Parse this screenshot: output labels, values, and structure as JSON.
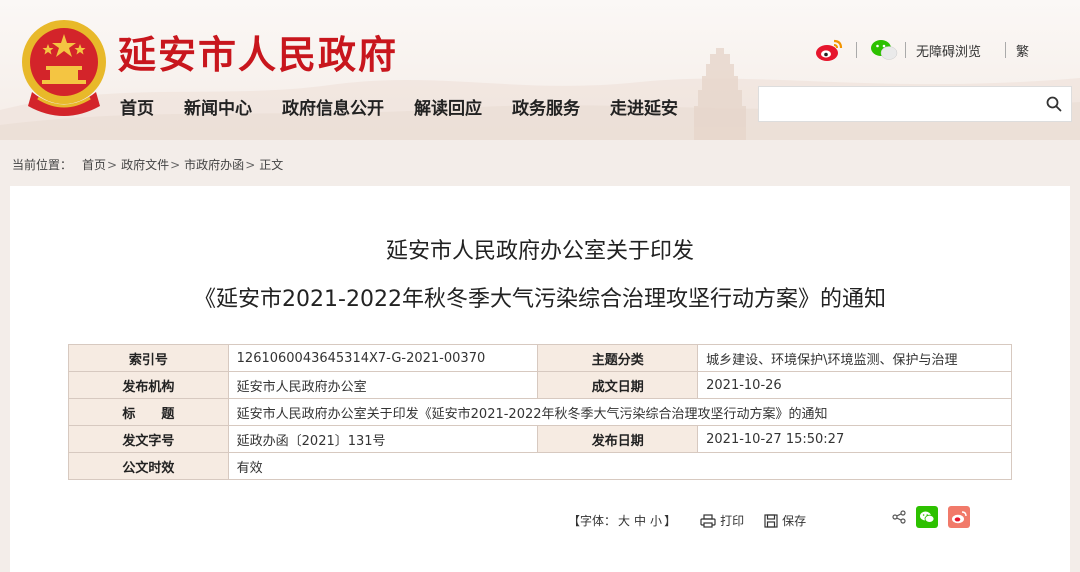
{
  "header": {
    "site_title": "延安市人民政府",
    "util": {
      "accessibility": "无障碍浏览",
      "traditional": "繁"
    },
    "nav": [
      "首页",
      "新闻中心",
      "政府信息公开",
      "解读回应",
      "政务服务",
      "走进延安"
    ],
    "search": {
      "placeholder": ""
    }
  },
  "breadcrumb": {
    "prefix": "当前位置：",
    "items": [
      "首页",
      "政府文件",
      "市政府办函",
      "正文"
    ],
    "sep": ">"
  },
  "document": {
    "title_line1": "延安市人民政府办公室关于印发",
    "title_line2": "《延安市2021-2022年秋冬季大气污染综合治理攻坚行动方案》的通知",
    "meta": {
      "index_label": "索引号",
      "index_value": "1261060043645314X7-G-2021-00370",
      "topic_label": "主题分类",
      "topic_value": "城乡建设、环境保护\\环境监测、保护与治理",
      "issuer_label": "发布机构",
      "issuer_value": "延安市人民政府办公室",
      "created_label": "成文日期",
      "created_value": "2021-10-26",
      "title_label": "标　　题",
      "title_value": "延安市人民政府办公室关于印发《延安市2021-2022年秋冬季大气污染综合治理攻坚行动方案》的通知",
      "docno_label": "发文字号",
      "docno_value": "延政办函〔2021〕131号",
      "published_label": "发布日期",
      "published_value": "2021-10-27 15:50:27",
      "validity_label": "公文时效",
      "validity_value": "有效"
    }
  },
  "tools": {
    "font_label": "【字体：",
    "font_large": "大",
    "font_medium": "中",
    "font_small": "小",
    "font_close": "】",
    "print": "打印",
    "save": "保存"
  },
  "colors": {
    "brand_red": "#c8161d",
    "background": "#f3ede9",
    "label_bg": "#f6ebe2",
    "wechat_green": "#2dc100",
    "weibo_red": "#e6162d"
  }
}
